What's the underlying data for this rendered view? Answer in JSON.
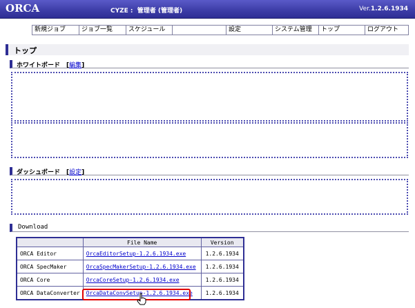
{
  "header": {
    "logo": "ORCA",
    "user": "CYZE :  管理者 (管理者)",
    "version_prefix": "Ver.",
    "version": "1.2.6.1934"
  },
  "menu": [
    {
      "label": "新規ジョブ",
      "width": 68
    },
    {
      "label": "ジョブ一覧",
      "width": 68
    },
    {
      "label": "スケジュール",
      "width": 67
    },
    {
      "label": "",
      "width": 78
    },
    {
      "label": "設定",
      "width": 67
    },
    {
      "label": "システム管理",
      "width": 67
    },
    {
      "label": "トップ",
      "width": 67
    },
    {
      "label": "ログアウト",
      "width": 62
    }
  ],
  "page_title": "トップ",
  "whiteboard": {
    "title": "ホワイトボード",
    "edit_link": "編集"
  },
  "dashboard": {
    "title": "ダッシュボード",
    "settings_link": "設定"
  },
  "download": {
    "title": "Download",
    "headers": [
      "",
      "File Name",
      "Version"
    ],
    "rows": [
      {
        "name": "ORCA Editor",
        "file": "OrcaEditorSetup-1.2.6.1934.exe",
        "version": "1.2.6.1934"
      },
      {
        "name": "ORCA SpecMaker",
        "file": "OrcaSpecMakerSetup-1.2.6.1934.exe",
        "version": "1.2.6.1934"
      },
      {
        "name": "ORCA Core",
        "file": "OrcaCoreSetup-1.2.6.1934.exe",
        "version": "1.2.6.1934"
      },
      {
        "name": "ORCA DataConverter",
        "file": "OrcaDataConvSetup-1.2.6.1934.exe",
        "version": "1.2.6.1934"
      }
    ]
  }
}
